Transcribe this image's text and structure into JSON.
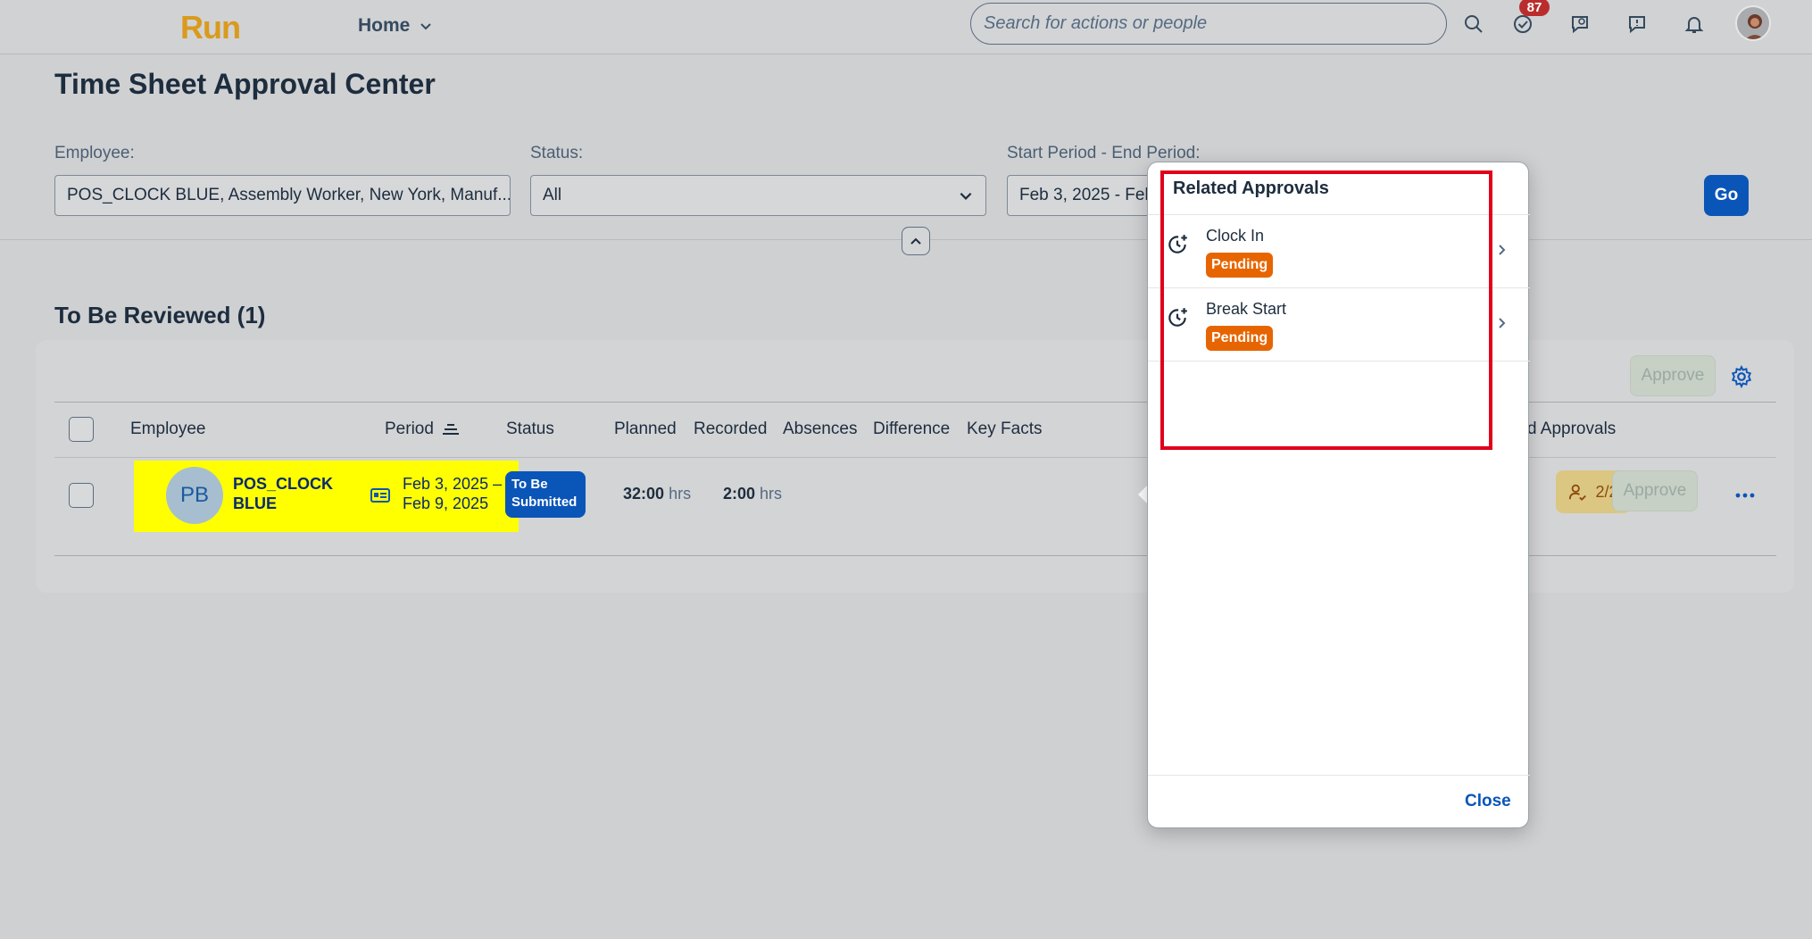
{
  "shell": {
    "logo": "Run",
    "home_label": "Home",
    "search_placeholder": "Search for actions or people",
    "notification_count": "87"
  },
  "page": {
    "title": "Time Sheet Approval Center"
  },
  "filters": {
    "employee_label": "Employee:",
    "employee_value": "POS_CLOCK BLUE, Assembly Worker, New York, Manuf...",
    "status_label": "Status:",
    "status_value": "All",
    "period_label": "Start Period - End Period:",
    "period_value": "Feb 3, 2025 - Feb",
    "go_label": "Go"
  },
  "table": {
    "section_title": "To Be Reviewed (1)",
    "approve_label": "Approve",
    "columns": {
      "employee": "Employee",
      "period": "Period",
      "status": "Status",
      "planned": "Planned",
      "recorded": "Recorded",
      "absences": "Absences",
      "difference": "Difference",
      "key_facts": "Key Facts",
      "related_approvals": "d Approvals"
    },
    "rows": [
      {
        "initials": "PB",
        "name": "POS_CLOCK BLUE",
        "period_start": "Feb 3, 2025 –",
        "period_end": "Feb 9, 2025",
        "status": "To Be Submitted",
        "planned": "32:00",
        "recorded": "2:00",
        "unit": "hrs",
        "related_approvals": "2/2",
        "approve_label": "Approve"
      }
    ]
  },
  "popover": {
    "title": "Related Approvals",
    "items": [
      {
        "label": "Clock In",
        "status": "Pending"
      },
      {
        "label": "Break Start",
        "status": "Pending"
      }
    ],
    "close_label": "Close"
  },
  "colors": {
    "brand_blue": "#0a55b8",
    "pending_orange": "#e76500",
    "highlight_yellow": "#ffff00",
    "annotation_red": "#e0001b",
    "logo_gold": "#d99a1e"
  }
}
